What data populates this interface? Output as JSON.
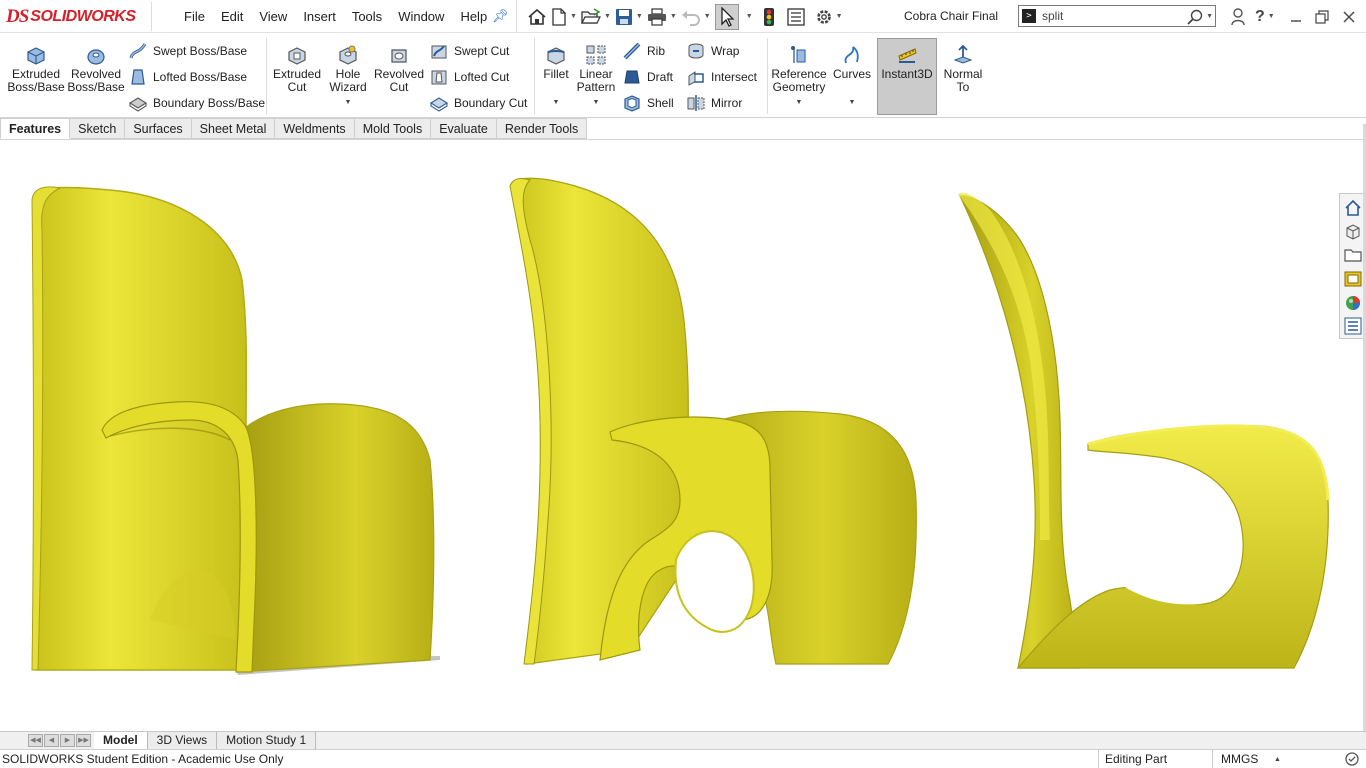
{
  "app": {
    "logo_prefix": "DS",
    "logo_text": "SOLIDWORKS"
  },
  "menu": [
    "File",
    "Edit",
    "View",
    "Insert",
    "Tools",
    "Window",
    "Help"
  ],
  "quick_access": [
    "home-icon",
    "new-document-icon",
    "open-icon",
    "save-icon",
    "print-icon",
    "undo-icon",
    "select-icon",
    "rebuild-icon",
    "file-properties-icon",
    "options-icon"
  ],
  "document_title": "Cobra Chair Final",
  "search": {
    "value": "split"
  },
  "command_manager": {
    "extruded_boss": "Extruded\nBoss/Base",
    "revolved_boss": "Revolved\nBoss/Base",
    "swept_boss": "Swept Boss/Base",
    "lofted_boss": "Lofted Boss/Base",
    "boundary_boss": "Boundary Boss/Base",
    "extruded_cut": "Extruded\nCut",
    "hole_wizard": "Hole\nWizard",
    "revolved_cut": "Revolved\nCut",
    "swept_cut": "Swept Cut",
    "lofted_cut": "Lofted Cut",
    "boundary_cut": "Boundary Cut",
    "fillet": "Fillet",
    "linear_pattern": "Linear\nPattern",
    "rib": "Rib",
    "draft": "Draft",
    "shell": "Shell",
    "wrap": "Wrap",
    "intersect": "Intersect",
    "mirror": "Mirror",
    "reference_geometry": "Reference\nGeometry",
    "curves": "Curves",
    "instant3d": "Instant3D",
    "normal_to": "Normal\nTo"
  },
  "tabs": [
    "Features",
    "Sketch",
    "Surfaces",
    "Sheet Metal",
    "Weldments",
    "Mold Tools",
    "Evaluate",
    "Render Tools"
  ],
  "active_tab": "Features",
  "model": {
    "color": "#e3dd2a"
  },
  "bottom_tabs": [
    "Model",
    "3D Views",
    "Motion Study 1"
  ],
  "status": {
    "edition": "SOLIDWORKS Student Edition - Academic Use Only",
    "mode": "Editing Part",
    "units": "MMGS"
  }
}
